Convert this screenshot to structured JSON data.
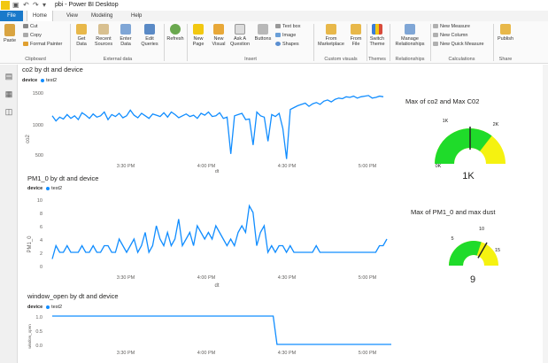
{
  "app": {
    "title": "pbi - Power BI Desktop",
    "menu": {
      "file": "File",
      "tabs": [
        "Home",
        "View",
        "Modeling",
        "Help"
      ]
    }
  },
  "ribbon": {
    "clipboard": {
      "paste": "Paste",
      "cut": "Cut",
      "copy": "Copy",
      "format_painter": "Format Painter",
      "group": "Clipboard"
    },
    "external": {
      "get_data": "Get Data",
      "recent_sources": "Recent Sources",
      "enter_data": "Enter Data",
      "edit_queries": "Edit Queries",
      "group": "External data"
    },
    "refresh": "Refresh",
    "insert": {
      "new_page": "New Page",
      "new_visual": "New Visual",
      "ask_question": "Ask A Question",
      "buttons": "Buttons",
      "text_box": "Text box",
      "image": "Image",
      "shapes": "Shapes",
      "group": "Insert"
    },
    "custom_visuals": {
      "from_marketplace": "From Marketplace",
      "from_file": "From File",
      "group": "Custom visuals"
    },
    "themes": {
      "switch_theme": "Switch Theme",
      "group": "Themes"
    },
    "relationships": {
      "manage": "Manage Relationships",
      "group": "Relationships"
    },
    "calculations": {
      "new_measure": "New Measure",
      "new_column": "New Column",
      "new_quick_measure": "New Quick Measure",
      "group": "Calculations"
    },
    "share": {
      "publish": "Publish",
      "group": "Share"
    }
  },
  "colors": {
    "series": "#118dff",
    "gauge_green": "#1fdb2a",
    "gauge_yellow": "#f5f210",
    "accent": "#1979ca"
  },
  "charts": {
    "co2": {
      "title": "co2 by dt and device",
      "legend_label": "device",
      "legend_series": "test2",
      "ylabel": "co2",
      "xlabel": "dt",
      "yticks": [
        "1500",
        "1000",
        "500"
      ],
      "xticks": [
        "3:30 PM",
        "4:00 PM",
        "4:30 PM",
        "5:00 PM"
      ]
    },
    "pm1": {
      "title": "PM1_0 by dt and device",
      "legend_label": "device",
      "legend_series": "test2",
      "ylabel": "PM1_0",
      "xlabel": "dt",
      "yticks": [
        "10",
        "8",
        "6",
        "4",
        "2",
        "0"
      ],
      "xticks": [
        "3:30 PM",
        "4:00 PM",
        "4:30 PM",
        "5:00 PM"
      ]
    },
    "window": {
      "title": "window_open by dt and device",
      "legend_label": "device",
      "legend_series": "test2",
      "ylabel": "window_open",
      "yticks": [
        "1.0",
        "0.5",
        "0.0"
      ],
      "xticks": [
        "3:30 PM",
        "4:00 PM",
        "4:30 PM",
        "5:00 PM"
      ]
    }
  },
  "gauges": {
    "co2": {
      "title": "Max of co2 and Max C02",
      "min_label": "0K",
      "target_label": "1K",
      "max_label": "2K",
      "value": "1K",
      "value_num": 1.42,
      "max_num": 2
    },
    "pm": {
      "title": "Max of PM1_0 and max dust",
      "min_label": "0",
      "target_label": "5",
      "target2_label": "10",
      "max_label": "15",
      "value": "9",
      "value_num": 9,
      "max_num": 15
    }
  },
  "chart_data": [
    {
      "type": "line",
      "title": "co2 by dt and device",
      "xlabel": "dt",
      "ylabel": "co2",
      "ylim": [
        400,
        1600
      ],
      "series": [
        {
          "name": "test2",
          "values": [
            1100,
            1020,
            1080,
            1050,
            1120,
            1060,
            1100,
            1040,
            1150,
            1110,
            1060,
            1130,
            1080,
            1100,
            1160,
            1040,
            1120,
            1090,
            1140,
            1070,
            1100,
            1190,
            1110,
            1070,
            1140,
            1100,
            1060,
            1130,
            1110,
            1090,
            1150,
            1080,
            1160,
            1120,
            1070,
            1100,
            1130,
            1090,
            1110,
            1060,
            1140,
            1110,
            1160,
            1090,
            1100,
            1150,
            1060,
            1080,
            500,
            1100,
            1120,
            1140,
            1040,
            1050,
            640,
            1160,
            1100,
            1080,
            700,
            1120,
            1090,
            1140,
            900,
            420,
            1200,
            1230,
            1260,
            1280,
            1300,
            1250,
            1290,
            1310,
            1280,
            1330,
            1350,
            1320,
            1360,
            1380,
            1370,
            1400,
            1390,
            1410,
            1380,
            1400,
            1410,
            1420,
            1380,
            1390,
            1410,
            1400
          ]
        }
      ]
    },
    {
      "type": "line",
      "title": "PM1_0 by dt and device",
      "xlabel": "dt",
      "ylabel": "PM1_0",
      "ylim": [
        0,
        10
      ],
      "series": [
        {
          "name": "test2",
          "values": [
            1,
            3,
            2,
            2,
            3,
            2,
            2,
            2,
            3,
            2,
            2,
            3,
            2,
            2,
            3,
            3,
            2,
            2,
            4,
            3,
            2,
            3,
            4,
            2,
            3,
            5,
            2,
            3,
            6,
            4,
            3,
            5,
            3,
            4,
            7,
            3,
            4,
            5,
            3,
            6,
            5,
            4,
            5,
            4,
            6,
            5,
            4,
            3,
            4,
            3,
            5,
            6,
            5,
            9,
            8,
            3,
            5,
            6,
            2,
            3,
            2,
            3,
            3,
            2,
            3,
            2,
            2,
            2,
            2,
            2,
            2,
            3,
            2,
            2,
            2,
            2,
            2,
            2,
            2,
            2,
            2,
            2,
            2,
            2,
            2,
            2,
            2,
            2,
            3,
            3,
            4
          ]
        }
      ]
    },
    {
      "type": "line",
      "title": "window_open by dt and device",
      "ylabel": "window_open",
      "ylim": [
        0,
        1
      ],
      "series": [
        {
          "name": "test2",
          "values": [
            1,
            1,
            1,
            1,
            1,
            1,
            1,
            1,
            1,
            1,
            1,
            1,
            1,
            1,
            1,
            1,
            1,
            1,
            1,
            1,
            1,
            1,
            1,
            1,
            1,
            1,
            1,
            1,
            1,
            1,
            1,
            1,
            1,
            1,
            1,
            1,
            1,
            1,
            1,
            1,
            1,
            1,
            1,
            1,
            1,
            1,
            1,
            1,
            1,
            1,
            1,
            1,
            1,
            1,
            1,
            1,
            1,
            1,
            1,
            0,
            0,
            0,
            0,
            0,
            0,
            0,
            0,
            0,
            0,
            0,
            0,
            0,
            0,
            0,
            0,
            0,
            0,
            0,
            0,
            0,
            0,
            0,
            0,
            0,
            0,
            0,
            0,
            0,
            0,
            0
          ]
        }
      ]
    }
  ]
}
